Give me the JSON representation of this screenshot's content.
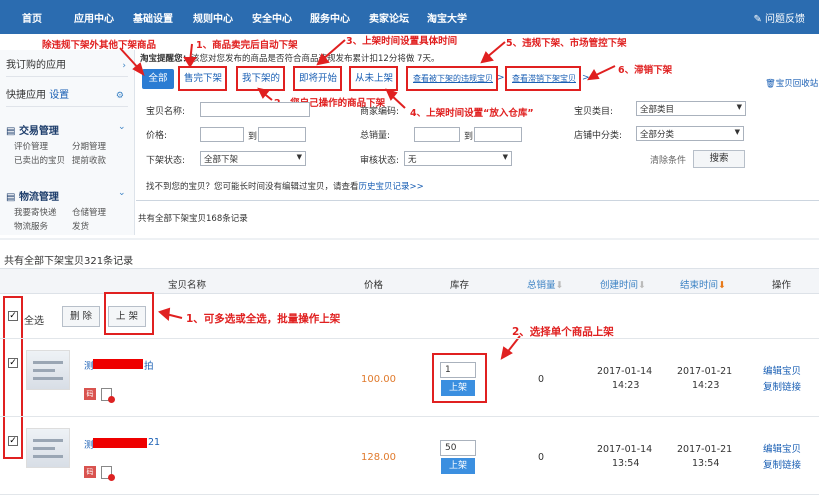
{
  "topnav": {
    "items": [
      "首页",
      "应用中心",
      "基础设置",
      "规则中心",
      "安全中心",
      "服务中心",
      "卖家论坛",
      "淘宝大学"
    ],
    "help": "问题反馈"
  },
  "sidebar": {
    "my_apps": "我订购的应用",
    "quick_apps": "快捷应用",
    "settings": "设置",
    "sections": [
      {
        "title": "交易管理",
        "links": [
          "评价管理",
          "分期管理",
          "已卖出的宝贝",
          "提前收款"
        ]
      },
      {
        "title": "物流管理",
        "links": [
          "我要寄快递",
          "仓储管理",
          "物流服务",
          "发货"
        ]
      }
    ]
  },
  "notice": {
    "label": "淘宝提醒您：",
    "text": "该您对您发布的商品是否符合商品违规发布累计扣12分将做 7天。"
  },
  "tabs": [
    "全部",
    "售完下架",
    "我下架的",
    "即将开始",
    "从未上架",
    "查看被下架的违规宝贝",
    "查看滞销下架宝贝"
  ],
  "recycle": "宝贝回收站",
  "filters": {
    "name": "宝贝名称:",
    "merchant_code": "商家编码:",
    "category": "宝贝类目:",
    "category_value": "全部类目",
    "price": "价格:",
    "to": "到",
    "sales": "总销量:",
    "shop_category": "店铺中分类:",
    "shop_category_value": "全部分类",
    "delist_status": "下架状态:",
    "delist_value": "全部下架",
    "review_status": "审核状态:",
    "review_value": "无",
    "clear": "清除条件",
    "search": "搜索",
    "tip": "找不到您的宝贝？您可能长时间没有编辑过宝贝，请查看",
    "history": "历史宝贝记录>>"
  },
  "summary_top": "共有全部下架宝贝168条记录",
  "summary_main": "共有全部下架宝贝321条记录",
  "table": {
    "headers": [
      "宝贝名称",
      "价格",
      "库存",
      "总销量",
      "创建时间",
      "结束时间",
      "操作"
    ],
    "select_all": "全选",
    "delete": "删 除",
    "list_up": "上 架",
    "rows": [
      {
        "title_prefix": "测",
        "title_suffix": "拍",
        "price": "100.00",
        "stock": "1",
        "sales": "0",
        "created_date": "2017-01-14",
        "created_time": "14:23",
        "end_date": "2017-01-21",
        "end_time": "14:23"
      },
      {
        "title_prefix": "测",
        "title_suffix": "21",
        "price": "128.00",
        "stock": "50",
        "sales": "0",
        "created_date": "2017-01-14",
        "created_time": "13:54",
        "end_date": "2017-01-21",
        "end_time": "13:54"
      }
    ],
    "row_up": "上架",
    "edit": "编辑宝贝",
    "copy": "复制链接",
    "code_icon": "码"
  },
  "annotations": {
    "a0": "除违规下架外其他下架商品",
    "a1": "1、商品卖完后自动下架",
    "a2": "2、您自己操作的商品下架",
    "a3": "3、上架时间设置具体时间",
    "a4": "4、上架时间设置“放入仓库”",
    "a5": "5、违规下架、市场管控下架",
    "a6": "6、滞销下架",
    "b1": "1、可多选或全选，批量操作上架",
    "b2": "2、选择单个商品上架"
  }
}
